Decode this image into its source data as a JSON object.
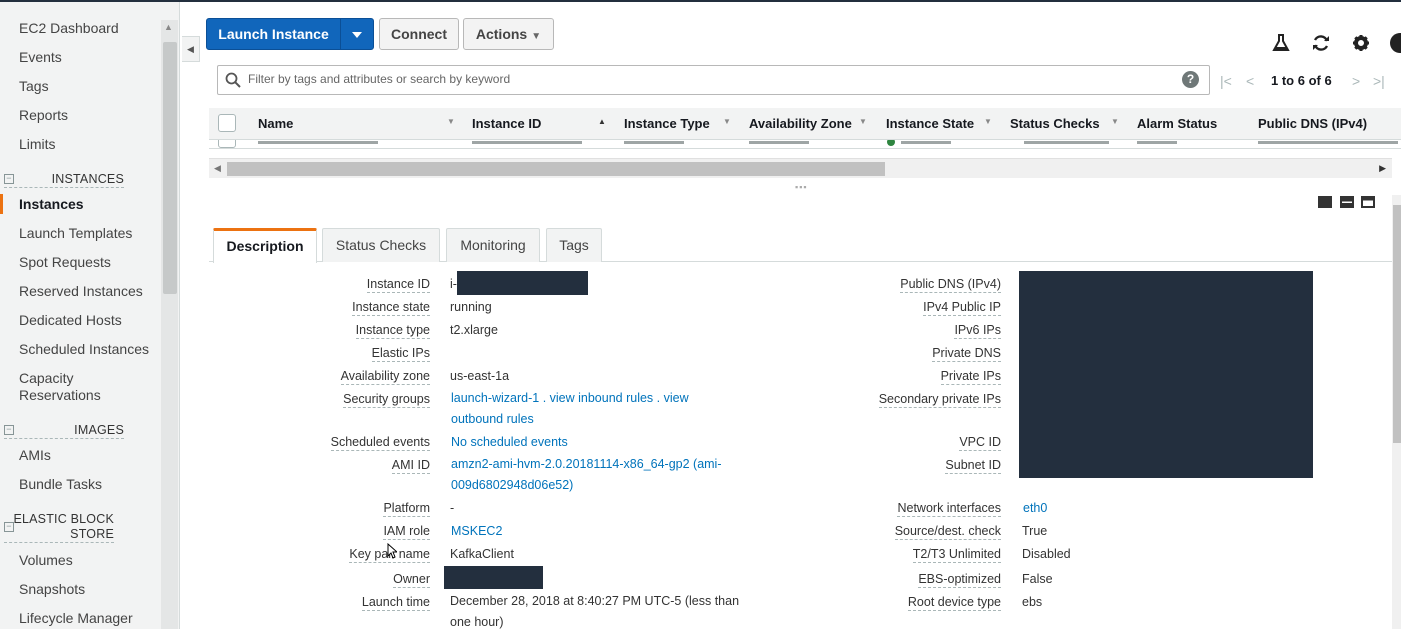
{
  "sidebar": {
    "items": [
      {
        "label": "EC2 Dashboard"
      },
      {
        "label": "Events"
      },
      {
        "label": "Tags"
      },
      {
        "label": "Reports"
      },
      {
        "label": "Limits"
      }
    ],
    "sections": [
      {
        "title": "INSTANCES",
        "items": [
          "Instances",
          "Launch Templates",
          "Spot Requests",
          "Reserved Instances",
          "Dedicated Hosts",
          "Scheduled Instances",
          "Capacity Reservations"
        ]
      },
      {
        "title": "IMAGES",
        "items": [
          "AMIs",
          "Bundle Tasks"
        ]
      },
      {
        "title": "ELASTIC BLOCK STORE",
        "items": [
          "Volumes",
          "Snapshots",
          "Lifecycle Manager"
        ]
      }
    ],
    "active_item": "Instances"
  },
  "toolbar": {
    "launch_label": "Launch Instance",
    "connect_label": "Connect",
    "actions_label": "Actions"
  },
  "search": {
    "placeholder": "Filter by tags and attributes or search by keyword"
  },
  "pagination": {
    "text": "1 to 6 of 6"
  },
  "table": {
    "columns": [
      "Name",
      "Instance ID",
      "Instance Type",
      "Availability Zone",
      "Instance State",
      "Status Checks",
      "Alarm Status",
      "Public DNS (IPv4)"
    ]
  },
  "tabs": [
    "Description",
    "Status Checks",
    "Monitoring",
    "Tags"
  ],
  "details": {
    "left": {
      "instance_id_label": "Instance ID",
      "instance_id_value": "i-",
      "instance_state_label": "Instance state",
      "instance_state_value": "running",
      "instance_type_label": "Instance type",
      "instance_type_value": "t2.xlarge",
      "elastic_ips_label": "Elastic IPs",
      "az_label": "Availability zone",
      "az_value": "us-east-1a",
      "sg_label": "Security groups",
      "sg_value": "launch-wizard-1 . view inbound rules . view outbound rules",
      "sched_label": "Scheduled events",
      "sched_value": "No scheduled events",
      "ami_label": "AMI ID",
      "ami_value": "amzn2-ami-hvm-2.0.20181114-x86_64-gp2 (ami-009d6802948d06e52)",
      "platform_label": "Platform",
      "platform_value": "-",
      "iam_label": "IAM role",
      "iam_value": "MSKEC2",
      "keypair_label": "Key pair name",
      "keypair_value": "KafkaClient",
      "owner_label": "Owner",
      "launch_label": "Launch time",
      "launch_value": "December 28, 2018 at 8:40:27 PM UTC-5 (less than one hour)"
    },
    "right": {
      "public_dns_label": "Public DNS (IPv4)",
      "ipv4_label": "IPv4 Public IP",
      "ipv6_label": "IPv6 IPs",
      "private_dns_label": "Private DNS",
      "private_ips_label": "Private IPs",
      "secondary_label": "Secondary private IPs",
      "vpc_label": "VPC ID",
      "subnet_label": "Subnet ID",
      "netif_label": "Network interfaces",
      "netif_value": "eth0",
      "srcdst_label": "Source/dest. check",
      "srcdst_value": "True",
      "t2t3_label": "T2/T3 Unlimited",
      "t2t3_value": "Disabled",
      "ebs_label": "EBS-optimized",
      "ebs_value": "False",
      "rootdev_label": "Root device type",
      "rootdev_value": "ebs"
    }
  },
  "colors": {
    "primary_button": "#1166bb",
    "active_tab_accent": "#ec7211",
    "link": "#0073bb",
    "redaction": "#232f3e"
  }
}
